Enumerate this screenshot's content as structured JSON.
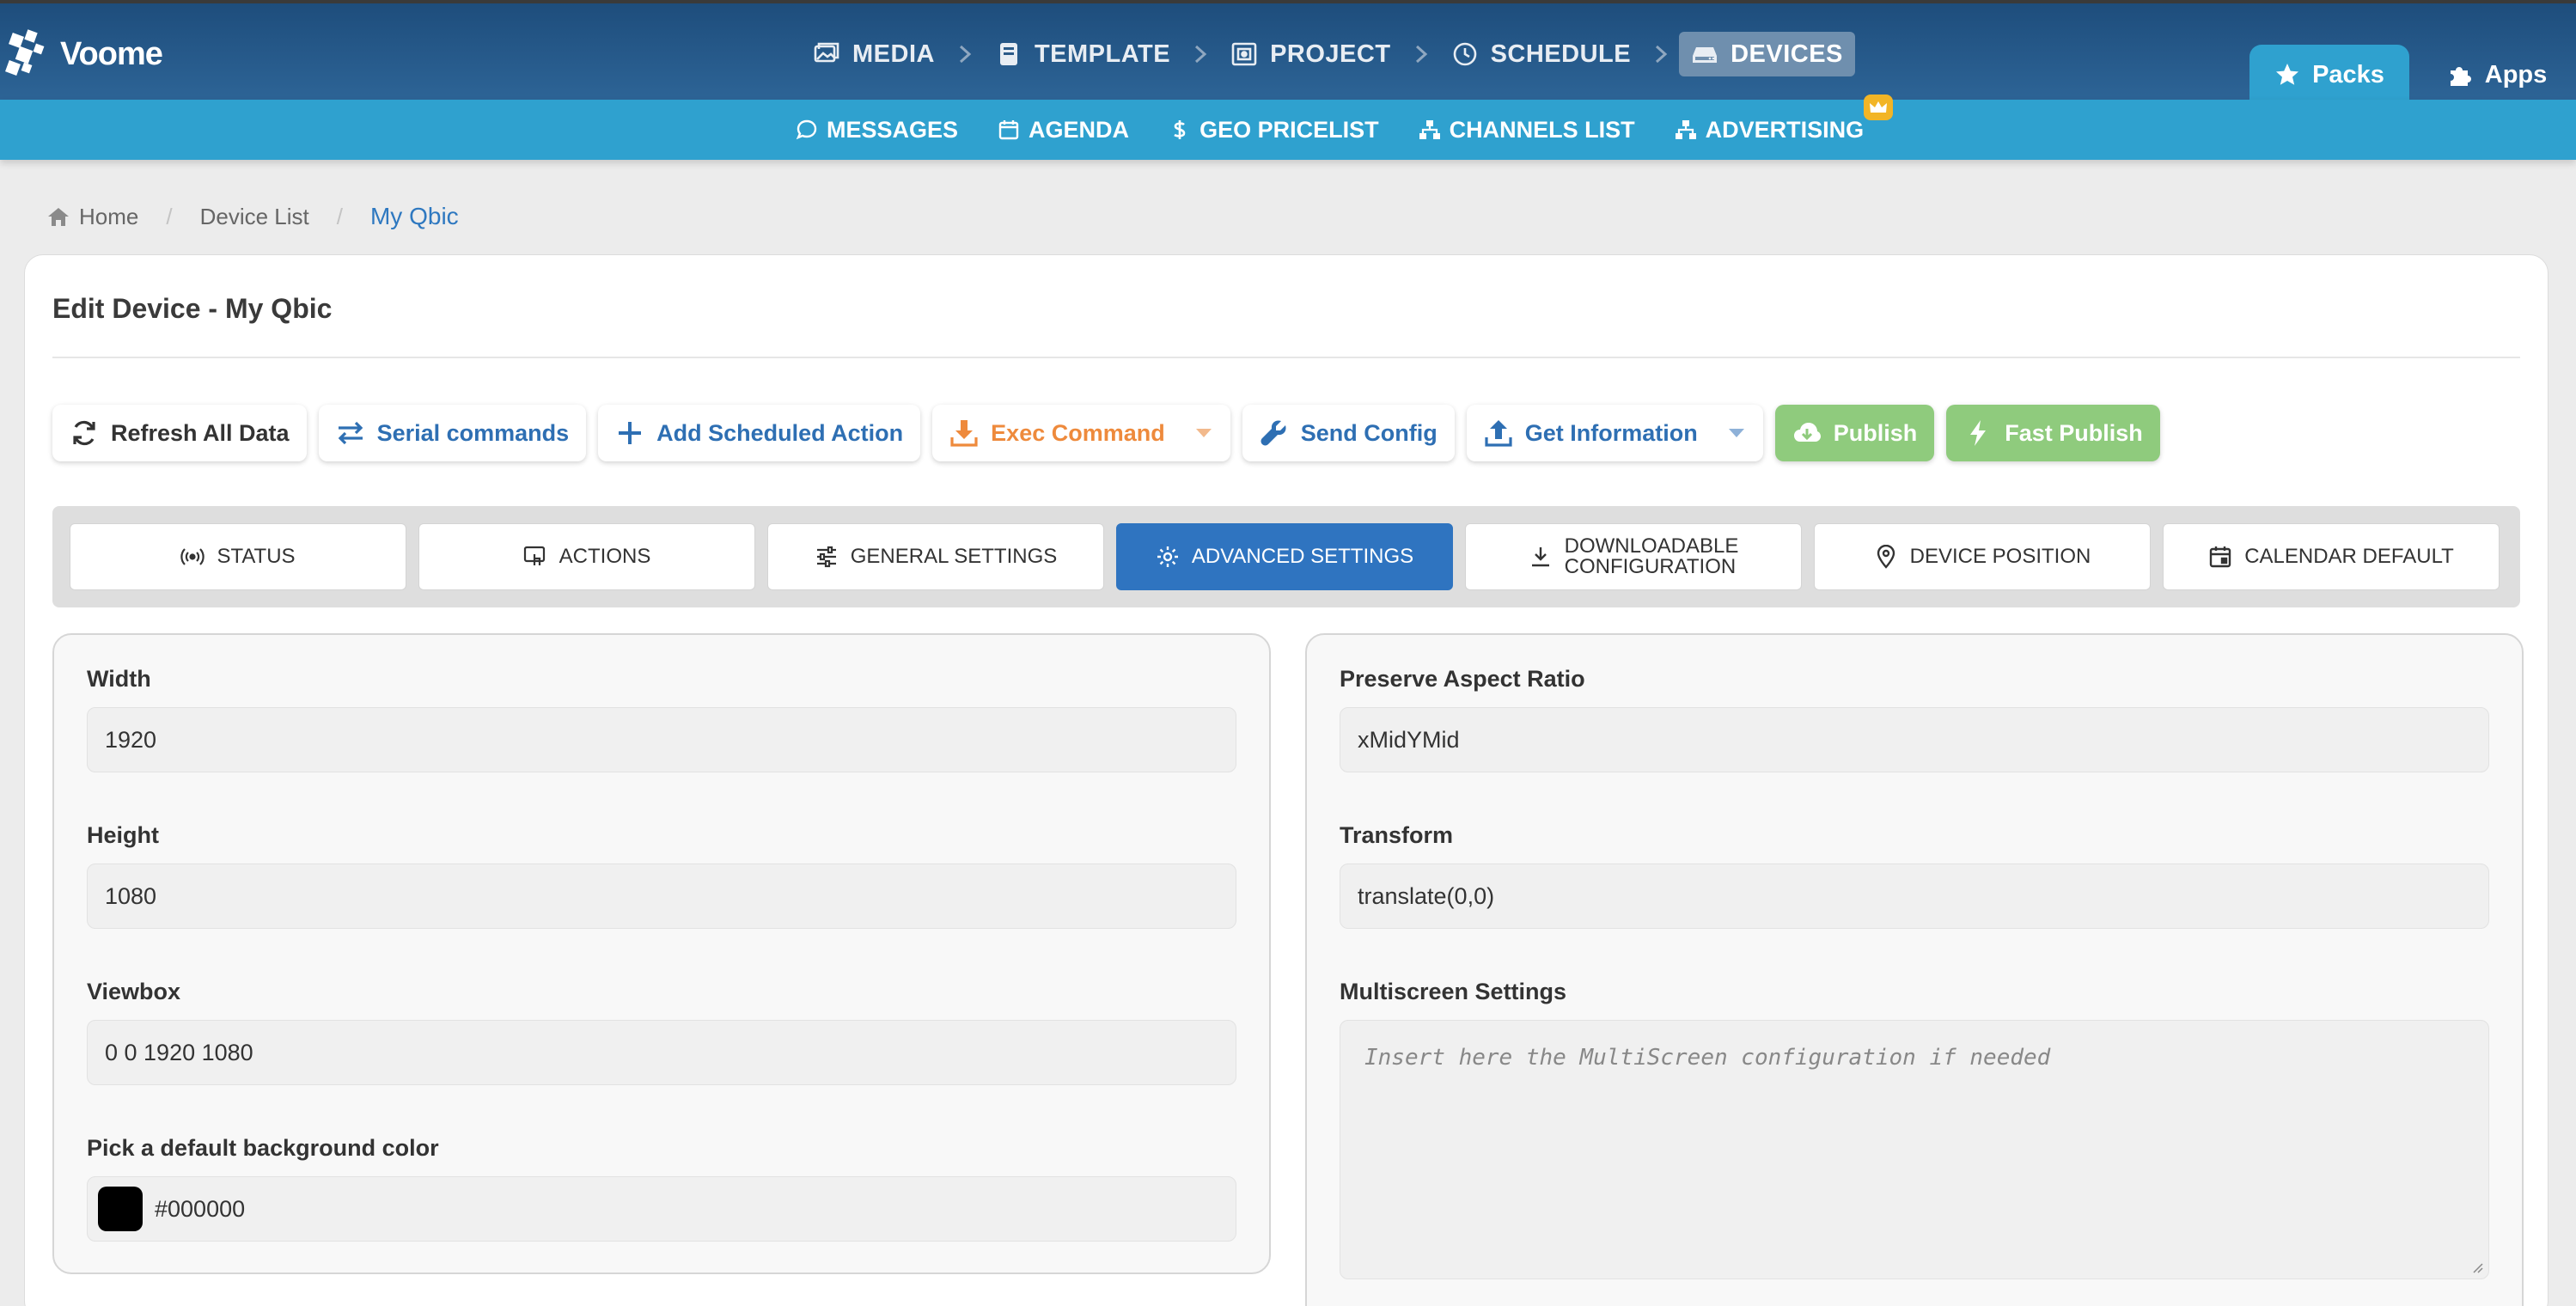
{
  "app": {
    "name": "Voome"
  },
  "main_nav": [
    {
      "label": "MEDIA",
      "icon": "image-icon"
    },
    {
      "label": "TEMPLATE",
      "icon": "book-icon"
    },
    {
      "label": "PROJECT",
      "icon": "project-icon"
    },
    {
      "label": "SCHEDULE",
      "icon": "clock-icon"
    },
    {
      "label": "DEVICES",
      "icon": "hdd-icon",
      "active": true
    }
  ],
  "top_tabs": {
    "packs": "Packs",
    "apps": "Apps"
  },
  "sub_nav": [
    {
      "label": "MESSAGES",
      "icon": "speech-bubble-icon"
    },
    {
      "label": "AGENDA",
      "icon": "calendar-icon"
    },
    {
      "label": "GEO PRICELIST",
      "icon": "dollar-icon"
    },
    {
      "label": "CHANNELS LIST",
      "icon": "sitemap-icon"
    },
    {
      "label": "ADVERTISING",
      "icon": "sitemap-icon",
      "badge": "crown-icon"
    }
  ],
  "breadcrumb": {
    "home": "Home",
    "device_list": "Device List",
    "current": "My Qbic"
  },
  "page_title": "Edit Device - My Qbic",
  "actions": {
    "refresh": "Refresh All Data",
    "serial": "Serial commands",
    "add_scheduled": "Add Scheduled Action",
    "exec": "Exec Command",
    "send_config": "Send Config",
    "get_info": "Get Information",
    "publish": "Publish",
    "fast_publish": "Fast Publish"
  },
  "tabs": {
    "status": "STATUS",
    "actions": "ACTIONS",
    "general": "GENERAL SETTINGS",
    "advanced": "ADVANCED SETTINGS",
    "downloadable_1": "DOWNLOADABLE",
    "downloadable_2": "CONFIGURATION",
    "position": "DEVICE POSITION",
    "calendar": "CALENDAR DEFAULT"
  },
  "left_panel": {
    "width_label": "Width",
    "width_value": "1920",
    "height_label": "Height",
    "height_value": "1080",
    "viewbox_label": "Viewbox",
    "viewbox_value": "0 0 1920 1080",
    "bg_label": "Pick a default background color",
    "bg_value": "#000000"
  },
  "right_panel": {
    "aspect_label": "Preserve Aspect Ratio",
    "aspect_value": "xMidYMid",
    "transform_label": "Transform",
    "transform_value": "translate(0,0)",
    "multiscreen_label": "Multiscreen Settings",
    "multiscreen_placeholder": "Insert here the MultiScreen configuration if needed"
  },
  "colors": {
    "topbar": "#1e4d7c",
    "subbar": "#2fa1cf",
    "accent_blue": "#2f74c0",
    "exec_orange": "#ee8a3c",
    "publish_green": "#8fcb7d",
    "crown": "#f2b526"
  }
}
